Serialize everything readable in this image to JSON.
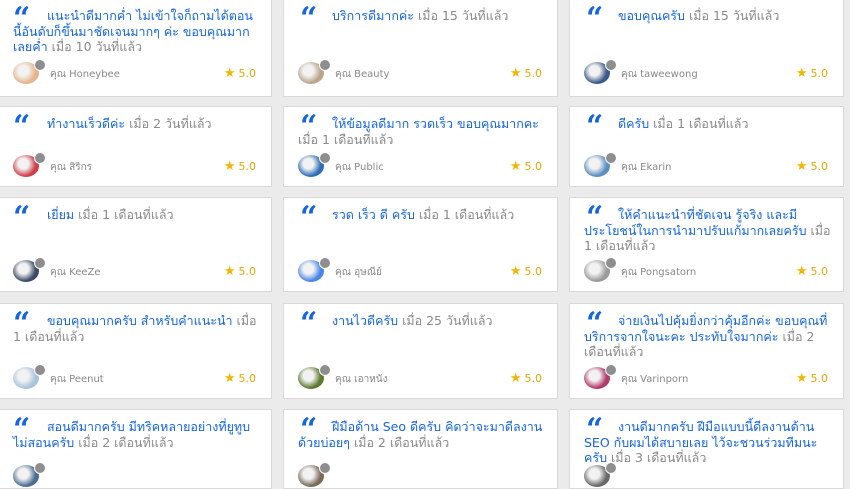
{
  "reviews": [
    {
      "msg": "แนะนำดีมากค่ำ ไม่เข้าใจก็ถามได้ตอนนี้อันดับก็ขึ้นมาชัดเจนมากๆ ค่ะ ขอบคุณมากเลยค่ำ",
      "when": "เมื่อ 10 วันที่แล้ว",
      "author": "คุณ Honeybee",
      "rating": "5.0",
      "avatar_color": "#e8b48c"
    },
    {
      "msg": "บริการดีมากค่ะ",
      "when": "เมื่อ 15 วันที่แล้ว",
      "author": "คุณ Beauty",
      "rating": "5.0",
      "avatar_color": "#b8a58a"
    },
    {
      "msg": "ขอบคุณครับ",
      "when": "เมื่อ 15 วันที่แล้ว",
      "author": "คุณ taweewong",
      "rating": "5.0",
      "avatar_color": "#3a5a88"
    },
    {
      "msg": "ทำงานเร็วดีค่ะ",
      "when": "เมื่อ 2 วันที่แล้ว",
      "author": "คุณ สิริกร",
      "rating": "5.0",
      "avatar_color": "#d0404a"
    },
    {
      "msg": "ให้ข้อมูลดีมาก รวดเร็ว ขอบคุณมากคะ",
      "when": "เมื่อ 1 เดือนที่แล้ว",
      "author": "คุณ Public",
      "rating": "5.0",
      "avatar_color": "#2f6fb8"
    },
    {
      "msg": "ดีครับ",
      "when": "เมื่อ 1 เดือนที่แล้ว",
      "author": "คุณ Ekarin",
      "rating": "5.0",
      "avatar_color": "#5c8fc0"
    },
    {
      "msg": "เยี่ยม",
      "when": "เมื่อ 1 เดือนที่แล้ว",
      "author": "คุณ KeeZe",
      "rating": "5.0",
      "avatar_color": "#3d4a66"
    },
    {
      "msg": "รวด เร็ว ดี ครับ",
      "when": "เมื่อ 1 เดือนที่แล้ว",
      "author": "คุณ อุษณีย์",
      "rating": "5.0",
      "avatar_color": "#4a86e8"
    },
    {
      "msg": "ให้คำแนะนำที่ชัดเจน รู้จริง และมีประโยชน์ในการนำมาปรับแก้มากเลยครับ",
      "when": "เมื่อ 1 เดือนที่แล้ว",
      "author": "คุณ Pongsatorn",
      "rating": "5.0",
      "avatar_color": "#9a9a9a"
    },
    {
      "msg": "ขอบคุณมากครับ สำหรับคำแนะนำ",
      "when": "เมื่อ 1 เดือนที่แล้ว",
      "author": "คุณ Peenut",
      "rating": "5.0",
      "avatar_color": "#a8c4dc"
    },
    {
      "msg": "งานไวดีครับ",
      "when": "เมื่อ 25 วันที่แล้ว",
      "author": "คุณ เอาหนัง",
      "rating": "5.0",
      "avatar_color": "#5e7a2e"
    },
    {
      "msg": "จ่ายเงินไปคุ้มยิ่งกว่าคุ้มอีกค่ะ ขอบคุณที่บริการจากใจนะคะ ประทับใจมากค่ะ",
      "when": "เมื่อ 2 เดือนที่แล้ว",
      "author": "คุณ Varinporn",
      "rating": "5.0",
      "avatar_color": "#b03a6a"
    },
    {
      "msg": "สอนดีมากครับ มีทริคหลายอย่างที่ยูทูบไม่สอนครับ",
      "when": "เมื่อ 2 เดือนที่แล้ว",
      "author": "",
      "rating": "",
      "avatar_color": "#4b6d92"
    },
    {
      "msg": "ฝีมือด้าน Seo ดีครับ คิดว่าจะมาดีลงานด้วยบ่อยๆ",
      "when": "เมื่อ 2 เดือนที่แล้ว",
      "author": "",
      "rating": "",
      "avatar_color": "#7a6a5a"
    },
    {
      "msg": "งานดีมากครับ ฝีมือแบบนี้ดีลงานด้าน SEO กับผมได้สบายเลย ไว้จะชวนร่วมทีมนะครับ",
      "when": "เมื่อ 3 เดือนที่แล้ว",
      "author": "",
      "rating": "",
      "avatar_color": "#6a6a6a"
    }
  ]
}
